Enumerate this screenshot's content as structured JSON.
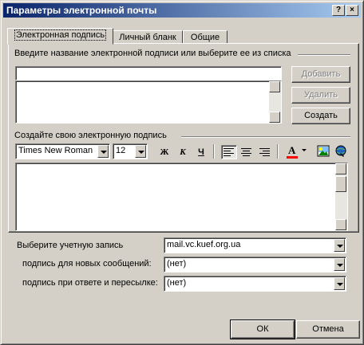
{
  "window": {
    "title": "Параметры электронной почты",
    "help_btn": "?",
    "close_btn": "×"
  },
  "tabs": [
    {
      "label": "Электронная подпись",
      "active": true
    },
    {
      "label": "Личный бланк"
    },
    {
      "label": "Общие"
    }
  ],
  "signature_group": {
    "caption": "Введите название электронной подписи или выберите ее из списка",
    "name_value": "",
    "add_label": "Добавить",
    "delete_label": "Удалить",
    "create_label": "Создать"
  },
  "editor_group": {
    "caption": "Создайте свою электронную подпись",
    "font_name": "Times New Roman",
    "font_size": "12",
    "bold": "Ж",
    "italic": "К",
    "underline": "Ч",
    "font_color_letter": "A",
    "body_text": ""
  },
  "account": {
    "label": "Выберите учетную запись",
    "value": "mail.vc.kuef.org.ua",
    "new_label": "подпись для новых сообщений:",
    "new_value": "(нет)",
    "reply_label": "подпись при ответе и пересылке:",
    "reply_value": "(нет)"
  },
  "footer": {
    "ok_label": "ОК",
    "cancel_label": "Отмена"
  },
  "colors": {
    "face": "#d4d0c8",
    "title_start": "#0a246a",
    "title_end": "#a6caf0",
    "font_color_bar": "#ff0000"
  }
}
